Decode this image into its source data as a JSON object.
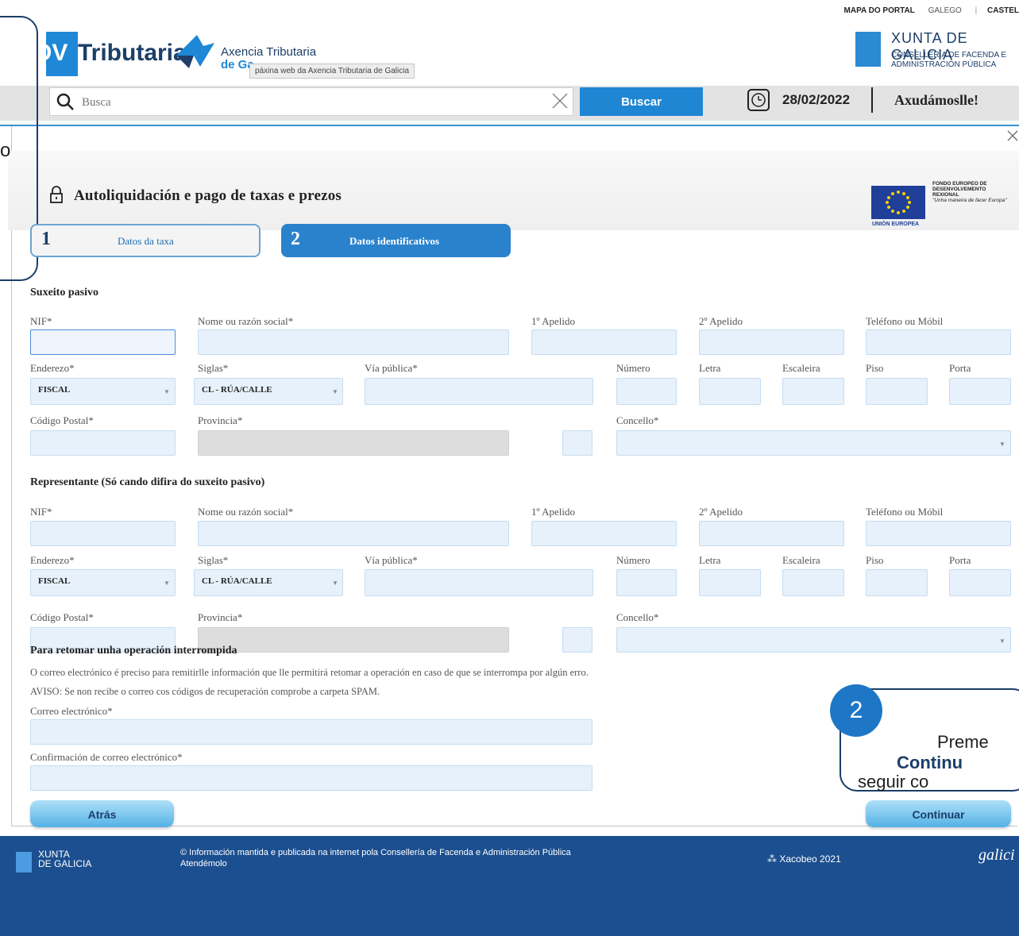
{
  "header": {
    "top_links": {
      "map": "MAPA DO PORTAL",
      "galego": "GALEGO",
      "sep": "|",
      "castellano": "CASTEL"
    },
    "logo_ov": "OV",
    "logo_text": "Tributaria",
    "agency_line1": "Axencia Tributaria",
    "agency_line2": "de Ga",
    "tooltip": "páxina web da Axencia Tributaria de Galicia",
    "xunta_name": "XUNTA DE GALICIA",
    "xunta_cons1": "CONSELLERÍA DE FACENDA E",
    "xunta_cons2": "ADMINISTRACIÓN PÚBLICA"
  },
  "search": {
    "placeholder": "Busca",
    "button": "Buscar",
    "date": "28/02/2022",
    "help": "Axudámoslle!"
  },
  "title": "Autoliquidación e pago de taxas e prezos",
  "eu": {
    "label": "UNIÓN EUROPEA",
    "fondo1": "FONDO EUROPEO DE",
    "fondo2": "DESENVOLVEMENTO",
    "fondo3": "REXIONAL",
    "fondo4": "\"Unha maneira de facer Europa\""
  },
  "callout1_text": "o",
  "steps": [
    {
      "num": "1",
      "label": "Datos da taxa"
    },
    {
      "num": "2",
      "label": "Datos identificativos"
    }
  ],
  "suxeito": {
    "title": "Suxeito pasivo",
    "nif": "NIF*",
    "nome": "Nome ou razón social*",
    "ap1": "1º Apelido",
    "ap2": "2º Apelido",
    "tel": "Teléfono ou Móbil",
    "enderezo": "Enderezo*",
    "siglas": "Siglas*",
    "via": "Vía pública*",
    "numero": "Número",
    "letra": "Letra",
    "escaleira": "Escaleira",
    "piso": "Piso",
    "porta": "Porta",
    "enderezo_val": "FISCAL",
    "siglas_val": "CL - RÚA/CALLE",
    "cp": "Código Postal*",
    "provincia": "Provincia*",
    "concello": "Concello*"
  },
  "representante": {
    "title": "Representante (Só cando difira do suxeito pasivo)",
    "nif": "NIF*",
    "nome": "Nome ou razón social*",
    "ap1": "1º Apelido",
    "ap2": "2º Apelido",
    "tel": "Teléfono ou Móbil",
    "enderezo": "Enderezo*",
    "siglas": "Siglas*",
    "via": "Vía pública*",
    "numero": "Número",
    "letra": "Letra",
    "escaleira": "Escaleira",
    "piso": "Piso",
    "porta": "Porta",
    "enderezo_val": "FISCAL",
    "siglas_val": "CL - RÚA/CALLE",
    "cp": "Código Postal*",
    "provincia": "Provincia*",
    "concello": "Concello*"
  },
  "retomar": {
    "title": "Para retomar unha operación interrompida",
    "info": "O correo electrónico é preciso para remitirlle información que lle permitirá retomar a operación en caso de que se interrompa por algún erro.",
    "aviso": "AVISO: Se non recibe o correo cos códigos de recuperación comprobe a carpeta SPAM.",
    "email": "Correo electrónico*",
    "email_confirm": "Confirmación de correo electrónico*"
  },
  "callout2": {
    "num": "2",
    "line1": "Preme",
    "line2": "Continu",
    "line3": "seguir co"
  },
  "buttons": {
    "back": "Atrás",
    "continue": "Continuar"
  },
  "footer": {
    "xunta1": "XUNTA",
    "xunta2": "DE GALICIA",
    "info1": "© Información mantida e publicada na internet pola Consellería de Facenda e Administración Pública",
    "info2": "Atendémolo",
    "xacobeo": "Xacobeo 2021",
    "galicia": "galici"
  }
}
